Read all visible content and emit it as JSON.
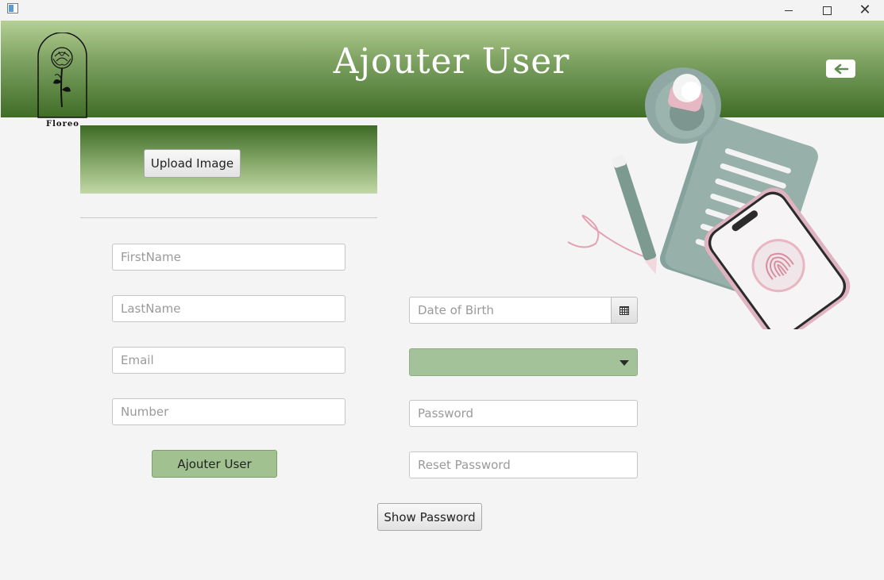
{
  "window": {
    "minimize_label": "",
    "maximize_label": "",
    "close_glyph": "✕"
  },
  "header": {
    "title": "Ajouter User",
    "back_icon": "arrow-left-icon",
    "gradient_top": "#b5cf93",
    "gradient_bottom": "#3f6d27"
  },
  "logo": {
    "label": "Floreo",
    "icon": "rose-icon"
  },
  "upload": {
    "button_label": "Upload Image"
  },
  "form": {
    "firstname_placeholder": "FirstName",
    "lastname_placeholder": "LastName",
    "email_placeholder": "Email",
    "number_placeholder": "Number",
    "dob_placeholder": "Date of Birth",
    "role_selected": "",
    "password_placeholder": "Password",
    "reset_password_placeholder": "Reset Password",
    "submit_label": "Ajouter User",
    "show_password_label": "Show Password"
  },
  "colors": {
    "accent_green": "#a1c191",
    "select_green": "#a3c29a",
    "back_arrow": "#5f8f4e"
  }
}
